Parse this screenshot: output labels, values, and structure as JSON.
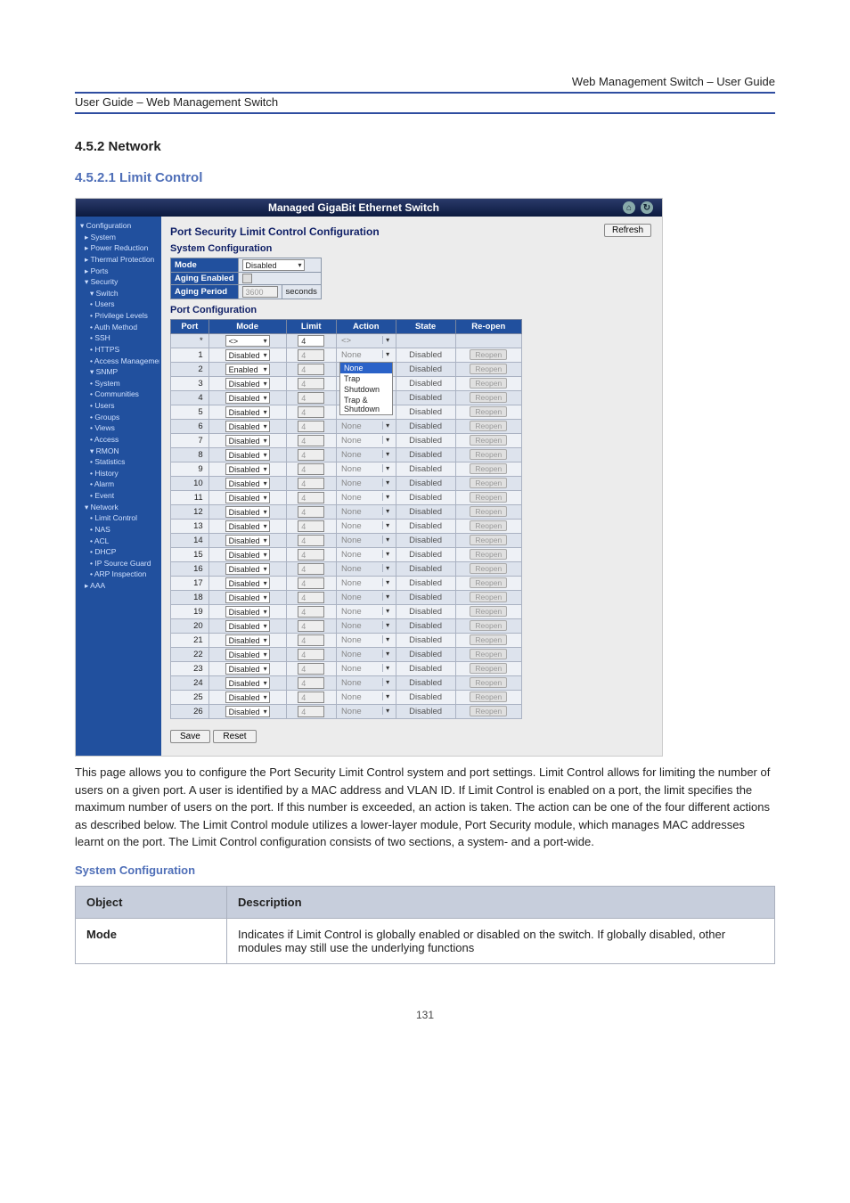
{
  "doc": {
    "header_line1": "Web Management Switch – User Guide",
    "header_line2": "User Guide – Web Management Switch",
    "footer": "131"
  },
  "section": {
    "title": "4.5.2 Network",
    "h2": "4.5.2.1 Limit Control",
    "body": "This page allows you to configure the Port Security Limit Control system and port settings. Limit Control allows for limiting the number of users on a given port. A user is identified by a MAC address and VLAN ID. If Limit Control is enabled on a port, the limit specifies the maximum number of users on the port. If this number is exceeded, an action is taken. The action can be one of the four different actions as described below. The Limit Control module utilizes a lower-layer module, Port Security module, which manages MAC addresses learnt on the port. The Limit Control configuration consists of two sections, a system- and a port-wide.",
    "h3": "System Configuration",
    "desc_headers": [
      "Object",
      "Description"
    ],
    "desc_rows": [
      {
        "label": "Mode",
        "text": "Indicates if Limit Control is globally enabled or disabled on the switch. If globally disabled, other modules may still use the underlying functions"
      }
    ]
  },
  "shot": {
    "toolbar_title": "Managed GigaBit Ethernet Switch",
    "refresh": "Refresh",
    "sidebar": [
      {
        "l": 1,
        "t": "▾ Configuration"
      },
      {
        "l": 2,
        "t": "▸ System"
      },
      {
        "l": 2,
        "t": "▸ Power Reduction"
      },
      {
        "l": 2,
        "t": "▸ Thermal Protection"
      },
      {
        "l": 2,
        "t": "▸ Ports"
      },
      {
        "l": 2,
        "t": "▾ Security"
      },
      {
        "l": 3,
        "t": "▾ Switch"
      },
      {
        "l": 3,
        "t": "• Users"
      },
      {
        "l": 3,
        "t": "• Privilege Levels"
      },
      {
        "l": 3,
        "t": "• Auth Method"
      },
      {
        "l": 3,
        "t": "• SSH"
      },
      {
        "l": 3,
        "t": "• HTTPS"
      },
      {
        "l": 3,
        "t": "• Access Management"
      },
      {
        "l": 3,
        "t": "▾ SNMP"
      },
      {
        "l": 3,
        "t": "• System"
      },
      {
        "l": 3,
        "t": "• Communities"
      },
      {
        "l": 3,
        "t": "• Users"
      },
      {
        "l": 3,
        "t": "• Groups"
      },
      {
        "l": 3,
        "t": "• Views"
      },
      {
        "l": 3,
        "t": "• Access"
      },
      {
        "l": 3,
        "t": "▾ RMON"
      },
      {
        "l": 3,
        "t": "• Statistics"
      },
      {
        "l": 3,
        "t": "• History"
      },
      {
        "l": 3,
        "t": "• Alarm"
      },
      {
        "l": 3,
        "t": "• Event"
      },
      {
        "l": 2,
        "t": "▾ Network"
      },
      {
        "l": 3,
        "t": "• Limit Control"
      },
      {
        "l": 3,
        "t": "• NAS"
      },
      {
        "l": 3,
        "t": "• ACL"
      },
      {
        "l": 3,
        "t": "• DHCP"
      },
      {
        "l": 3,
        "t": "• IP Source Guard"
      },
      {
        "l": 3,
        "t": "• ARP Inspection"
      },
      {
        "l": 2,
        "t": "▸ AAA"
      }
    ],
    "main_title": "Port Security Limit Control Configuration",
    "sys_sub": "System Configuration",
    "sys_rows": {
      "mode_label": "Mode",
      "mode_val": "Disabled",
      "aging_en_label": "Aging Enabled",
      "aging_pd_label": "Aging Period",
      "aging_pd_val": "3600",
      "aging_pd_unit": "seconds"
    },
    "port_sub": "Port Configuration",
    "port_headers": [
      "Port",
      "Mode",
      "Limit",
      "Action",
      "State",
      "Re-open"
    ],
    "star_row": {
      "port": "*",
      "mode": "<>",
      "limit": "4",
      "action": "<>"
    },
    "action_options": [
      "None",
      "Trap",
      "Shutdown",
      "Trap & Shutdown"
    ],
    "ports": [
      {
        "n": 1,
        "mode": "Disabled",
        "limit": "4",
        "action": "None",
        "state": "Disabled"
      },
      {
        "n": 2,
        "mode": "Enabled",
        "limit": "4",
        "action": "None",
        "state": "Disabled"
      },
      {
        "n": 3,
        "mode": "Disabled",
        "limit": "4",
        "action": "None",
        "state": "Disabled"
      },
      {
        "n": 4,
        "mode": "Disabled",
        "limit": "4",
        "action": "None",
        "state": "Disabled"
      },
      {
        "n": 5,
        "mode": "Disabled",
        "limit": "4",
        "action": "None",
        "state": "Disabled"
      },
      {
        "n": 6,
        "mode": "Disabled",
        "limit": "4",
        "action": "None",
        "state": "Disabled"
      },
      {
        "n": 7,
        "mode": "Disabled",
        "limit": "4",
        "action": "None",
        "state": "Disabled"
      },
      {
        "n": 8,
        "mode": "Disabled",
        "limit": "4",
        "action": "None",
        "state": "Disabled"
      },
      {
        "n": 9,
        "mode": "Disabled",
        "limit": "4",
        "action": "None",
        "state": "Disabled"
      },
      {
        "n": 10,
        "mode": "Disabled",
        "limit": "4",
        "action": "None",
        "state": "Disabled"
      },
      {
        "n": 11,
        "mode": "Disabled",
        "limit": "4",
        "action": "None",
        "state": "Disabled"
      },
      {
        "n": 12,
        "mode": "Disabled",
        "limit": "4",
        "action": "None",
        "state": "Disabled"
      },
      {
        "n": 13,
        "mode": "Disabled",
        "limit": "4",
        "action": "None",
        "state": "Disabled"
      },
      {
        "n": 14,
        "mode": "Disabled",
        "limit": "4",
        "action": "None",
        "state": "Disabled"
      },
      {
        "n": 15,
        "mode": "Disabled",
        "limit": "4",
        "action": "None",
        "state": "Disabled"
      },
      {
        "n": 16,
        "mode": "Disabled",
        "limit": "4",
        "action": "None",
        "state": "Disabled"
      },
      {
        "n": 17,
        "mode": "Disabled",
        "limit": "4",
        "action": "None",
        "state": "Disabled"
      },
      {
        "n": 18,
        "mode": "Disabled",
        "limit": "4",
        "action": "None",
        "state": "Disabled"
      },
      {
        "n": 19,
        "mode": "Disabled",
        "limit": "4",
        "action": "None",
        "state": "Disabled"
      },
      {
        "n": 20,
        "mode": "Disabled",
        "limit": "4",
        "action": "None",
        "state": "Disabled"
      },
      {
        "n": 21,
        "mode": "Disabled",
        "limit": "4",
        "action": "None",
        "state": "Disabled"
      },
      {
        "n": 22,
        "mode": "Disabled",
        "limit": "4",
        "action": "None",
        "state": "Disabled"
      },
      {
        "n": 23,
        "mode": "Disabled",
        "limit": "4",
        "action": "None",
        "state": "Disabled"
      },
      {
        "n": 24,
        "mode": "Disabled",
        "limit": "4",
        "action": "None",
        "state": "Disabled"
      },
      {
        "n": 25,
        "mode": "Disabled",
        "limit": "4",
        "action": "None",
        "state": "Disabled"
      },
      {
        "n": 26,
        "mode": "Disabled",
        "limit": "4",
        "action": "None",
        "state": "Disabled"
      }
    ],
    "reopen_label": "Reopen",
    "save": "Save",
    "reset": "Reset"
  }
}
